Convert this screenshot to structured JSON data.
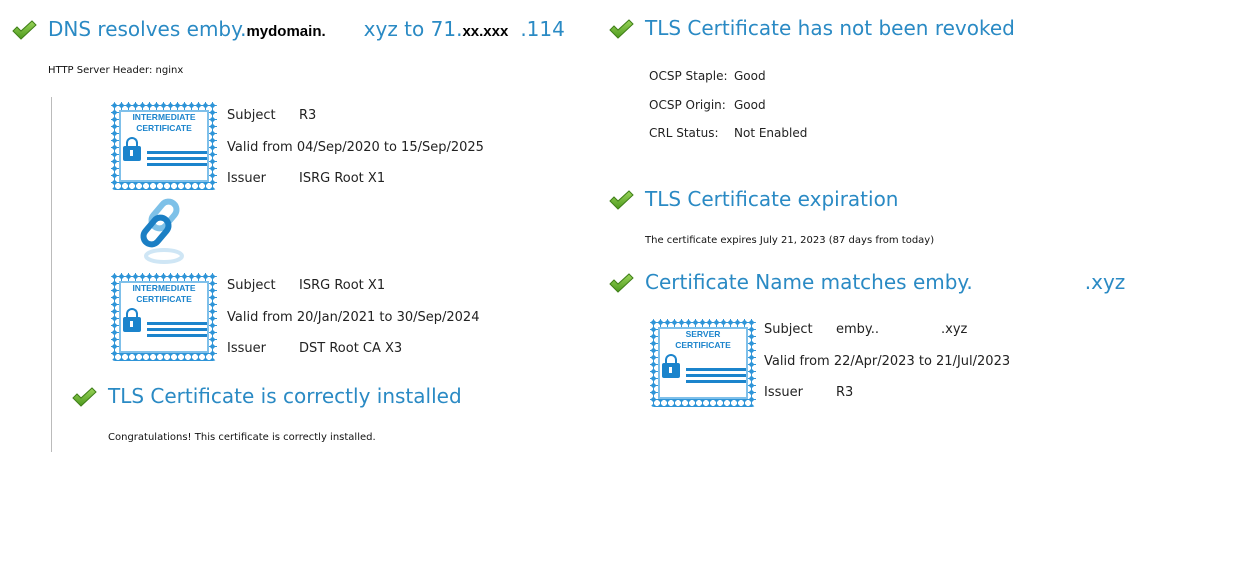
{
  "dns": {
    "prefix": "DNS resolves emby.",
    "domain_mask": "mydomain.",
    "middle": "xyz to 71.",
    "ip_mask": "xx.xxx",
    "suffix": ".114",
    "server_header": "HTTP Server Header: nginx"
  },
  "chain": [
    {
      "badge_line1": "INTERMEDIATE",
      "badge_line2": "CERTIFICATE",
      "subject_label": "Subject",
      "subject": "R3",
      "valid": "Valid from 04/Sep/2020 to 15/Sep/2025",
      "issuer_label": "Issuer",
      "issuer": "ISRG Root X1"
    },
    {
      "badge_line1": "INTERMEDIATE",
      "badge_line2": "CERTIFICATE",
      "subject_label": "Subject",
      "subject": "ISRG Root X1",
      "valid": "Valid from 20/Jan/2021 to 30/Sep/2024",
      "issuer_label": "Issuer",
      "issuer": "DST Root CA X3"
    }
  ],
  "installed": {
    "title": "TLS Certificate is correctly installed",
    "text": "Congratulations! This certificate is correctly installed."
  },
  "revoked": {
    "title": "TLS Certificate has not been revoked",
    "rows": [
      {
        "label": "OCSP Staple:",
        "value": "Good"
      },
      {
        "label": "OCSP Origin:",
        "value": "Good"
      },
      {
        "label": "CRL Status:",
        "value": "Not Enabled"
      }
    ]
  },
  "expiration": {
    "title": "TLS Certificate expiration",
    "text": "The certificate expires July 21, 2023 (87 days from today)"
  },
  "name_match": {
    "title_prefix": "Certificate Name matches emby.",
    "title_suffix": ".xyz",
    "cert": {
      "badge_line1": "SERVER",
      "badge_line2": "CERTIFICATE",
      "subject_label": "Subject",
      "subject_prefix": "emby..",
      "subject_suffix": ".xyz",
      "valid": "Valid from 22/Apr/2023 to 21/Jul/2023",
      "issuer_label": "Issuer",
      "issuer": "R3"
    }
  },
  "colors": {
    "heading": "#2a8ac4",
    "check": "#6cb52d",
    "cert": "#2f95d8"
  }
}
